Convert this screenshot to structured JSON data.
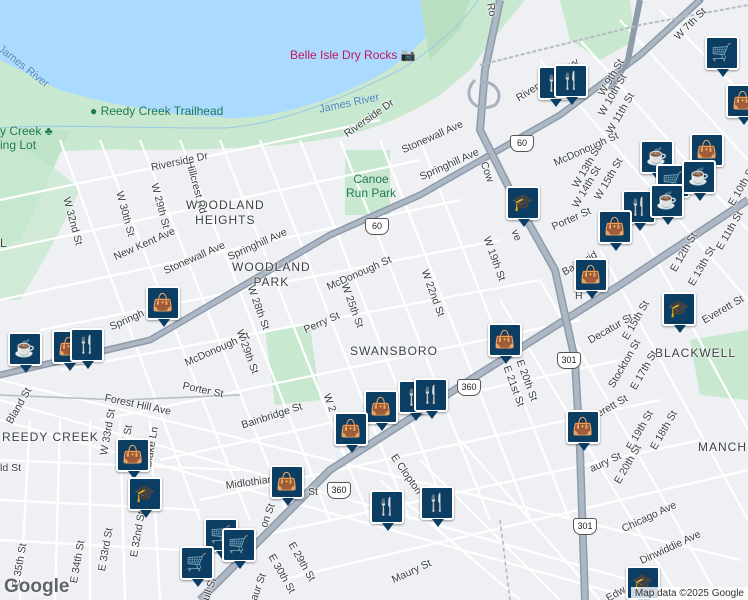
{
  "water_labels": [
    {
      "id": "james-river-1",
      "text": "James River"
    },
    {
      "id": "james-river-2",
      "text": "James River"
    }
  ],
  "pois": [
    {
      "id": "belle-isle",
      "text": "Belle Isle Dry Rocks",
      "icon": "camera-icon"
    },
    {
      "id": "reedy-creek-trailhead",
      "text": "Reedy Creek Trailhead",
      "icon": "park-icon"
    },
    {
      "id": "reedy-creek-lot",
      "line1": "y Creek",
      "line2": "ing Lot",
      "icon": "tree-icon"
    },
    {
      "id": "canoe-run-park",
      "line1": "Canoe",
      "line2": "Run Park"
    }
  ],
  "areas": [
    {
      "id": "woodland-heights",
      "line1": "WOODLAND",
      "line2": "HEIGHTS"
    },
    {
      "id": "woodland-park",
      "line1": "WOODLAND",
      "line2": "PARK"
    },
    {
      "id": "swansboro",
      "line1": "SWANSBORO"
    },
    {
      "id": "blackwell",
      "line1": "BLACKWELL"
    },
    {
      "id": "reedy-creek",
      "line1": "REEDY CREEK"
    },
    {
      "id": "manch",
      "line1": "MANCH"
    },
    {
      "id": "left-l",
      "line1": "L"
    }
  ],
  "streets": [
    {
      "id": "riverside-dr-1",
      "text": "Riverside Dr"
    },
    {
      "id": "riverside-dr-2",
      "text": "Riverside Dr"
    },
    {
      "id": "hillcrest-rd",
      "text": "Hillcrest Rd"
    },
    {
      "id": "w29th-1",
      "text": "W 29th St"
    },
    {
      "id": "w30th-1",
      "text": "W 30th St"
    },
    {
      "id": "w32nd",
      "text": "W 32nd St"
    },
    {
      "id": "new-kent",
      "text": "New Kent Ave"
    },
    {
      "id": "stonewall-1",
      "text": "Stonewall Ave"
    },
    {
      "id": "stonewall-2",
      "text": "Stonewall Ave"
    },
    {
      "id": "springhill-1",
      "text": "Springhill Ave"
    },
    {
      "id": "springhill-2",
      "text": "Springhill Ave"
    },
    {
      "id": "springh-3",
      "text": "Springh"
    },
    {
      "id": "mcdonough-1",
      "text": "McDonough St"
    },
    {
      "id": "mcdonough-2",
      "text": "McDonough St"
    },
    {
      "id": "mcdonough-3",
      "text": "McDonough St"
    },
    {
      "id": "w28th",
      "text": "W 28th St"
    },
    {
      "id": "w29th-2",
      "text": "W 29th St"
    },
    {
      "id": "perry",
      "text": "Perry St"
    },
    {
      "id": "w25th",
      "text": "W 25th St"
    },
    {
      "id": "w22nd",
      "text": "W 22nd St"
    },
    {
      "id": "w19th",
      "text": "W 19th St"
    },
    {
      "id": "porter-1",
      "text": "Porter St"
    },
    {
      "id": "porter-2",
      "text": "Porter St"
    },
    {
      "id": "forest-hill",
      "text": "Forest Hill Ave"
    },
    {
      "id": "bainbridge-1",
      "text": "Bainbridge St"
    },
    {
      "id": "bainbridge-2",
      "text": "Bainbrid"
    },
    {
      "id": "w2",
      "text": "W 2"
    },
    {
      "id": "bland",
      "text": "Bland St"
    },
    {
      "id": "w33rd",
      "text": "W 33rd St"
    },
    {
      "id": "nd-st",
      "text": "2nd St"
    },
    {
      "id": "blake-ln",
      "text": "Blake Ln"
    },
    {
      "id": "ld-st",
      "text": "ld St"
    },
    {
      "id": "midlothian",
      "text": "Midlothian Tpke"
    },
    {
      "id": "e35th",
      "text": "E 35th St"
    },
    {
      "id": "e34th",
      "text": "E 34th St"
    },
    {
      "id": "e33rd",
      "text": "E 33rd St"
    },
    {
      "id": "e32nd",
      "text": "E 32nd St"
    },
    {
      "id": "e29th",
      "text": "E 29th St"
    },
    {
      "id": "e30th",
      "text": "E 30th St"
    },
    {
      "id": "on-st",
      "text": "on St"
    },
    {
      "id": "st-frag",
      "text": "St"
    },
    {
      "id": "all-st",
      "text": "ull St"
    },
    {
      "id": "aur-st",
      "text": "aur St"
    },
    {
      "id": "e-clopton",
      "text": "E Clopton"
    },
    {
      "id": "maury-1",
      "text": "Maury St"
    },
    {
      "id": "maury-2",
      "text": "aury St"
    },
    {
      "id": "e20th",
      "text": "E 20th St"
    },
    {
      "id": "e21st",
      "text": "E 21st St"
    },
    {
      "id": "decatur",
      "text": "Decatur St"
    },
    {
      "id": "stockton",
      "text": "Stockton St"
    },
    {
      "id": "everett-1",
      "text": "Everett St"
    },
    {
      "id": "everett-2",
      "text": "verett St"
    },
    {
      "id": "e15th",
      "text": "E 15th St"
    },
    {
      "id": "e17th",
      "text": "E 17th St"
    },
    {
      "id": "e18th",
      "text": "E 18th St"
    },
    {
      "id": "e19th",
      "text": "E 19th St"
    },
    {
      "id": "e20th-2",
      "text": "E 20th St"
    },
    {
      "id": "e10th",
      "text": "E 10th St"
    },
    {
      "id": "e11th",
      "text": "E 11th St"
    },
    {
      "id": "e12th",
      "text": "E 12th St"
    },
    {
      "id": "e13th",
      "text": "E 13th St"
    },
    {
      "id": "chicago",
      "text": "Chicago Ave"
    },
    {
      "id": "dinwiddie",
      "text": "Dinwiddie Ave"
    },
    {
      "id": "edw",
      "text": "Edw"
    },
    {
      "id": "w7th",
      "text": "W 7th St"
    },
    {
      "id": "w9th",
      "text": "W 9th St"
    },
    {
      "id": "w10th",
      "text": "W 10th St"
    },
    {
      "id": "w11th",
      "text": "W 11th St"
    },
    {
      "id": "w13th",
      "text": "W 13th St"
    },
    {
      "id": "w14th",
      "text": "W 14th St"
    },
    {
      "id": "w15th",
      "text": "W 15th St"
    },
    {
      "id": "riverside-pkwy",
      "text": "Riverside Pkwy"
    },
    {
      "id": "cowardin",
      "text": "Cow"
    },
    {
      "id": "cowardin-2",
      "text": "ve"
    },
    {
      "id": "highway-top",
      "text": "Ro"
    },
    {
      "id": "hull-h",
      "text": "H"
    }
  ],
  "shields": [
    {
      "id": "shield-60-1",
      "text": "60"
    },
    {
      "id": "shield-60-2",
      "text": "60"
    },
    {
      "id": "shield-360-1",
      "text": "360"
    },
    {
      "id": "shield-360-2",
      "text": "360"
    },
    {
      "id": "shield-301-1",
      "text": "301"
    },
    {
      "id": "shield-301-2",
      "text": "301"
    }
  ],
  "markers": [
    {
      "id": "m1",
      "type": "grocery",
      "icon": "shopping-cart-icon"
    },
    {
      "id": "m2",
      "type": "restaurant",
      "icon": "fork-knife-icon"
    },
    {
      "id": "m3",
      "type": "restaurant",
      "icon": "fork-knife-icon"
    },
    {
      "id": "m4",
      "type": "school",
      "icon": "graduation-cap-icon"
    },
    {
      "id": "m5",
      "type": "cafe",
      "icon": "coffee-cup-icon"
    },
    {
      "id": "m6",
      "type": "shopping",
      "icon": "shopping-bag-icon"
    },
    {
      "id": "m7",
      "type": "grocery",
      "icon": "shopping-cart-icon"
    },
    {
      "id": "m8",
      "type": "cafe",
      "icon": "coffee-cup-icon"
    },
    {
      "id": "m9",
      "type": "restaurant",
      "icon": "fork-knife-icon"
    },
    {
      "id": "m10",
      "type": "shopping",
      "icon": "shopping-bag-icon"
    },
    {
      "id": "m11",
      "type": "shopping",
      "icon": "shopping-bag-icon"
    },
    {
      "id": "m12",
      "type": "school",
      "icon": "graduation-cap-icon"
    },
    {
      "id": "m13",
      "type": "shopping",
      "icon": "shopping-bag-icon"
    },
    {
      "id": "m14",
      "type": "cafe",
      "icon": "coffee-cup-icon"
    },
    {
      "id": "m15",
      "type": "shopping",
      "icon": "shopping-bag-icon"
    },
    {
      "id": "m16",
      "type": "shopping",
      "icon": "shopping-bag-icon"
    },
    {
      "id": "m17",
      "type": "restaurant",
      "icon": "fork-knife-icon"
    },
    {
      "id": "m18",
      "type": "restaurant",
      "icon": "fork-knife-icon"
    },
    {
      "id": "m19",
      "type": "shopping",
      "icon": "shopping-bag-icon"
    },
    {
      "id": "m20",
      "type": "shopping",
      "icon": "shopping-bag-icon"
    },
    {
      "id": "m21",
      "type": "shopping",
      "icon": "shopping-bag-icon"
    },
    {
      "id": "m22",
      "type": "school",
      "icon": "graduation-cap-icon"
    },
    {
      "id": "m23",
      "type": "shopping",
      "icon": "shopping-bag-icon"
    },
    {
      "id": "m24",
      "type": "restaurant",
      "icon": "fork-knife-icon"
    },
    {
      "id": "m25",
      "type": "restaurant",
      "icon": "fork-knife-icon"
    },
    {
      "id": "m26",
      "type": "grocery",
      "icon": "shopping-cart-icon"
    },
    {
      "id": "m27",
      "type": "grocery",
      "icon": "shopping-cart-icon"
    },
    {
      "id": "m28",
      "type": "grocery",
      "icon": "shopping-cart-icon"
    },
    {
      "id": "m29",
      "type": "shopping",
      "icon": "shopping-bag-icon"
    },
    {
      "id": "m30",
      "type": "school",
      "icon": "graduation-cap-icon"
    },
    {
      "id": "m31",
      "type": "cafe",
      "icon": "coffee-cup-icon"
    },
    {
      "id": "m32",
      "type": "shopping",
      "icon": "shopping-bag-icon"
    },
    {
      "id": "m33",
      "type": "restaurant",
      "icon": "fork-knife-icon"
    }
  ],
  "footer": {
    "logo": "Google",
    "attribution": "Map data ©2025 Google"
  }
}
